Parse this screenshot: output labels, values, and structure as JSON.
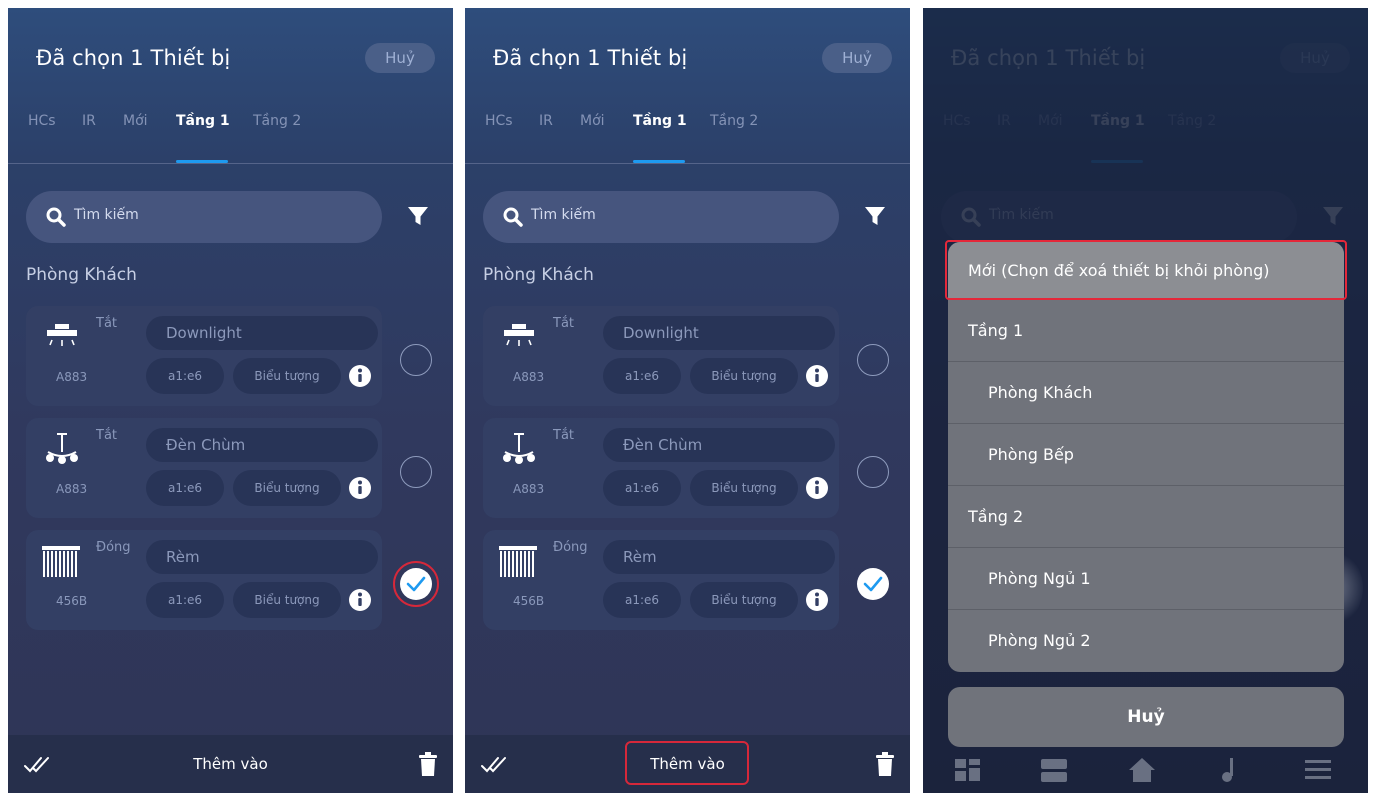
{
  "header": {
    "title": "Đã chọn 1 Thiết bị",
    "cancel_label": "Huỷ"
  },
  "tabs": [
    {
      "label": "HCs",
      "active": false
    },
    {
      "label": "IR",
      "active": false
    },
    {
      "label": "Mới",
      "active": false
    },
    {
      "label": "Tầng 1",
      "active": true
    },
    {
      "label": "Tầng 2",
      "active": false
    }
  ],
  "search": {
    "placeholder": "Tìm kiếm"
  },
  "section_title": "Phòng Khách",
  "devices": [
    {
      "icon": "downlight-icon",
      "state": "Tắt",
      "id": "A883",
      "name": "Downlight",
      "address": "a1:e6",
      "icon_label": "Biểu tượng",
      "selected": false
    },
    {
      "icon": "chandelier-icon",
      "state": "Tắt",
      "id": "A883",
      "name": "Đèn Chùm",
      "address": "a1:e6",
      "icon_label": "Biểu tượng",
      "selected": false
    },
    {
      "icon": "curtain-icon",
      "state": "Đóng",
      "id": "456B",
      "name": "Rèm",
      "address": "a1:e6",
      "icon_label": "Biểu tượng",
      "selected": true
    }
  ],
  "bottom_bar": {
    "add_label": "Thêm vào"
  },
  "move_sheet": {
    "items": [
      {
        "label": "Mới (Chọn để xoá thiết bị khỏi phòng)",
        "level": "top"
      },
      {
        "label": "Tầng 1",
        "level": "top"
      },
      {
        "label": "Phòng Khách",
        "level": "sub"
      },
      {
        "label": "Phòng Bếp",
        "level": "sub"
      },
      {
        "label": "Tầng 2",
        "level": "top"
      },
      {
        "label": "Phòng Ngủ 1",
        "level": "sub"
      },
      {
        "label": "Phòng Ngủ 2",
        "level": "sub"
      }
    ],
    "cancel_label": "Huỷ"
  },
  "colors": {
    "accent": "#1e9af0",
    "highlight": "#d6283a",
    "panel_bg": "#2f3556"
  }
}
